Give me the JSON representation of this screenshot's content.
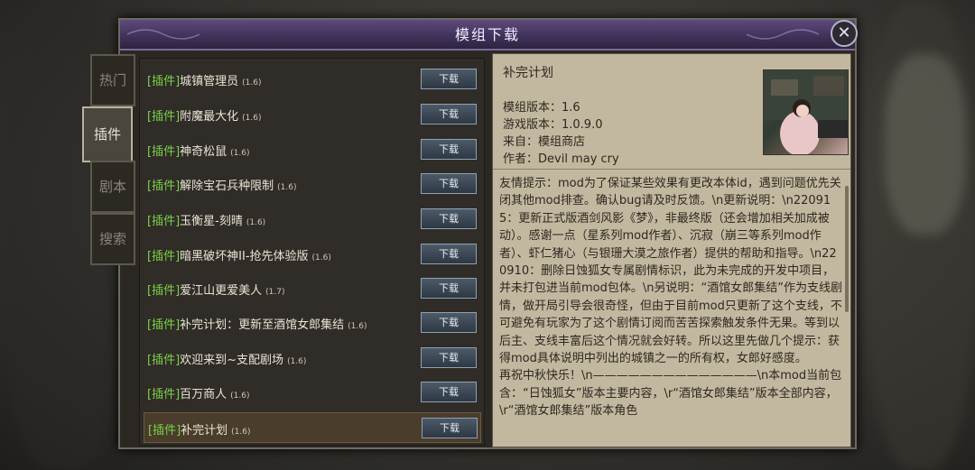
{
  "window": {
    "title": "模组下载"
  },
  "tabs": [
    {
      "label": "热门"
    },
    {
      "label": "插件",
      "active": true
    },
    {
      "label": "剧本"
    },
    {
      "label": "搜索"
    }
  ],
  "mods": [
    {
      "tag": "[插件]",
      "name": "城镇管理员",
      "version": "(1.6)",
      "button": "下载"
    },
    {
      "tag": "[插件]",
      "name": "附魔最大化",
      "version": "(1.6)",
      "button": "下载"
    },
    {
      "tag": "[插件]",
      "name": "神奇松鼠",
      "version": "(1.6)",
      "button": "下载"
    },
    {
      "tag": "[插件]",
      "name": "解除宝石兵种限制",
      "version": "(1.6)",
      "button": "下载"
    },
    {
      "tag": "[插件]",
      "name": "玉衡星-刻晴",
      "version": "(1.6)",
      "button": "下载"
    },
    {
      "tag": "[插件]",
      "name": "暗黑破坏神II-抢先体验版",
      "version": "(1.6)",
      "button": "下载"
    },
    {
      "tag": "[插件]",
      "name": "爱江山更爱美人",
      "version": "(1.7)",
      "button": "下载"
    },
    {
      "tag": "[插件]",
      "name": "补完计划：更新至酒馆女郎集结",
      "version": "(1.6)",
      "button": "下载"
    },
    {
      "tag": "[插件]",
      "name": "欢迎来到~支配剧场",
      "version": "(1.6)",
      "button": "下载"
    },
    {
      "tag": "[插件]",
      "name": "百万商人",
      "version": "(1.6)",
      "button": "下载"
    },
    {
      "tag": "[插件]",
      "name": "补完计划",
      "version": "(1.6)",
      "button": "下载",
      "selected": true
    }
  ],
  "detail": {
    "title": "补完计划",
    "mod_version": "模组版本：1.6",
    "game_version": "游戏版本：1.0.9.0",
    "source": "来自：模组商店",
    "author": "作者：Devil may cry",
    "description": "友情提示：mod为了保证某些效果有更改本体id，遇到问题优先关闭其他mod排查。确认bug请及时反馈。\\n更新说明：\\n220915：更新正式版酒剑风影《梦》，非最终版（还会增加相关加成被动）。感谢一点（星系列mod作者）、沉寂（崩三等系列mod作者）、虾仁猪心（与银珊大漠之旅作者）提供的帮助和指导。\\n220910：删除日蚀狐女专属剧情标识，此为未完成的开发中项目，并未打包进当前mod包体。\\n另说明：“酒馆女郎集结”作为支线剧情，做开局引导会很奇怪，但由于目前mod只更新了这个支线，不可避免有玩家为了这个剧情订阅而苦苦探索触发条件无果。等到以后主、支线丰富后这个情况就会好转。所以这里先做几个提示：获得mod具体说明中列出的城镇之一的所有权，女郎好感度。　　　再祝中秋快乐！\\n——————————————\\n本mod当前包含：“日蚀狐女”版本主要内容，\\r“酒馆女郎集结”版本全部内容，\\r“酒馆女郎集结”版本角色"
  }
}
